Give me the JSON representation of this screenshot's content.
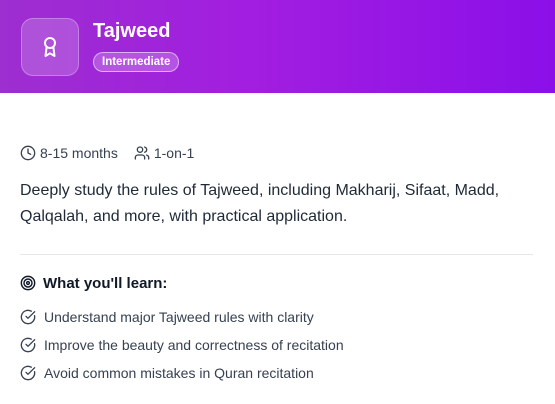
{
  "course": {
    "title": "Tajweed",
    "level": "Intermediate",
    "duration": "8-15 months",
    "format": "1-on-1",
    "description": "Deeply study the rules of Tajweed, including Makharij, Sifaat, Madd, Qalqalah, and more, with practical application."
  },
  "learn": {
    "heading": "What you'll learn:",
    "items": [
      "Understand major Tajweed rules with clarity",
      "Improve the beauty and correctness of recitation",
      "Avoid common mistakes in Quran recitation"
    ]
  },
  "icons": {
    "header": "award-icon",
    "duration": "clock-icon",
    "format": "users-icon",
    "heading": "target-icon",
    "item": "check-circle-icon"
  },
  "colors": {
    "header_gradient_start": "#9d2ed0",
    "header_gradient_end": "#8b0fe8",
    "text_primary": "#1f2937",
    "text_secondary": "#374151"
  }
}
